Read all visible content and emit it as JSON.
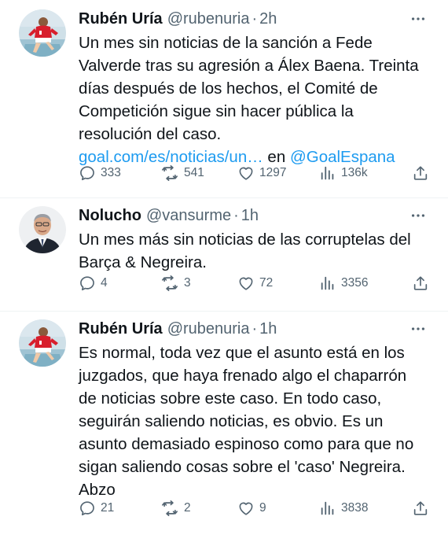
{
  "tweets": [
    {
      "author": {
        "name": "Rubén Uría",
        "handle": "@rubenuria"
      },
      "separator": "·",
      "time": "2h",
      "text_lines": [
        "Un mes sin noticias de la sanción a Fede",
        "Valverde tras su agresión a Álex Baena. Treinta",
        "días después de los hechos, el Comité de",
        "Competición sigue sin hacer pública la",
        "resolución del caso."
      ],
      "link": {
        "url_text": "goal.com/es/noticias/un…",
        "connector": " en ",
        "mention": "@GoalEspana"
      },
      "stats": {
        "replies": "333",
        "retweets": "541",
        "likes": "1297",
        "views": "136k"
      },
      "avatar_icon": "avatar-footballer-red-shirt"
    },
    {
      "author": {
        "name": "Nolucho",
        "handle": "@vansurme"
      },
      "separator": "·",
      "time": "1h",
      "text_lines": [
        "Un mes más sin noticias de las corruptelas del",
        "Barça & Negreira."
      ],
      "stats": {
        "replies": "4",
        "retweets": "3",
        "likes": "72",
        "views": "3356"
      },
      "avatar_icon": "avatar-man-in-suit"
    },
    {
      "author": {
        "name": "Rubén Uría",
        "handle": "@rubenuria"
      },
      "separator": "·",
      "time": "1h",
      "text_lines": [
        "Es normal, toda vez que el asunto está en los",
        "juzgados, que haya frenado algo el chaparrón",
        "de noticias sobre este caso. En todo caso,",
        "seguirán saliendo noticias, es obvio. Es un",
        "asunto demasiado espinoso como para que no",
        "sigan saliendo cosas sobre el 'caso' Negreira.",
        "Abzo"
      ],
      "stats": {
        "replies": "21",
        "retweets": "2",
        "likes": "9",
        "views": "3838"
      },
      "avatar_icon": "avatar-footballer-red-shirt"
    }
  ],
  "icons": {
    "reply": "reply-icon",
    "retweet": "retweet-icon",
    "like": "like-icon",
    "views": "views-icon",
    "share": "share-icon",
    "more": "more-icon"
  },
  "colors": {
    "text": "#0f1419",
    "muted": "#536471",
    "link": "#1d9bf0"
  }
}
